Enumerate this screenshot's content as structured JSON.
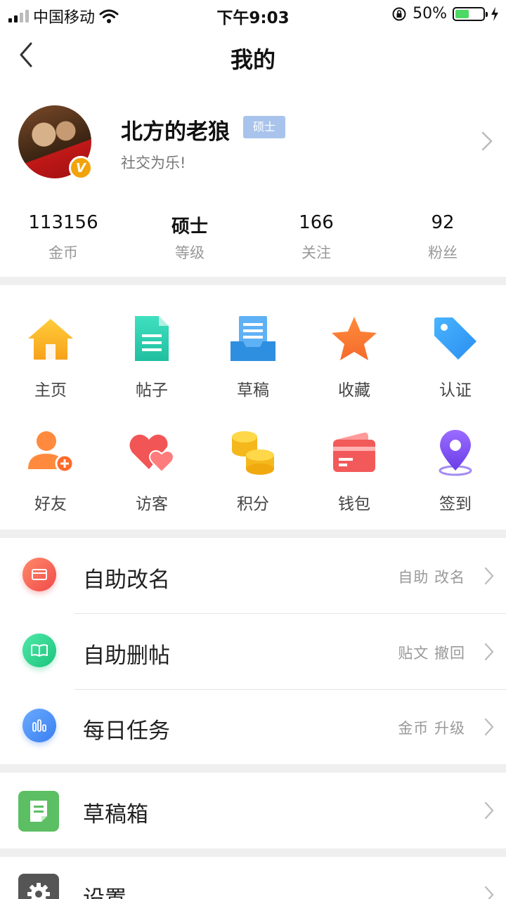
{
  "status_bar": {
    "carrier": "中国移动",
    "time": "下午9:03",
    "battery_percent": "50%",
    "battery_level": 0.5
  },
  "nav": {
    "title": "我的"
  },
  "profile": {
    "username": "北方的老狼",
    "level_badge": "硕士",
    "motto": "社交为乐!",
    "verified_badge": "V"
  },
  "stats": [
    {
      "value": "113156",
      "label": "金币"
    },
    {
      "value": "硕士",
      "label": "等级"
    },
    {
      "value": "166",
      "label": "关注"
    },
    {
      "value": "92",
      "label": "粉丝"
    }
  ],
  "grid": [
    {
      "label": "主页",
      "icon": "home-icon"
    },
    {
      "label": "帖子",
      "icon": "document-icon"
    },
    {
      "label": "草稿",
      "icon": "draft-tray-icon"
    },
    {
      "label": "收藏",
      "icon": "star-icon"
    },
    {
      "label": "认证",
      "icon": "tag-icon"
    },
    {
      "label": "好友",
      "icon": "add-friend-icon"
    },
    {
      "label": "访客",
      "icon": "hearts-icon"
    },
    {
      "label": "积分",
      "icon": "coins-icon"
    },
    {
      "label": "钱包",
      "icon": "wallet-icon"
    },
    {
      "label": "签到",
      "icon": "location-pin-icon"
    }
  ],
  "list": [
    {
      "title": "自助改名",
      "subtitle": "自助  改名",
      "icon": "card-icon",
      "color": "#f36a5a"
    },
    {
      "title": "自助删帖",
      "subtitle": "贴文  撤回",
      "icon": "book-icon",
      "color": "#2fd18a"
    },
    {
      "title": "每日任务",
      "subtitle": "金币  升级",
      "icon": "bar-chart-icon",
      "color": "#4a8df0"
    }
  ],
  "drafts": {
    "title": "草稿箱",
    "icon": "draft-box-icon",
    "color": "#5cbf63"
  },
  "settings": {
    "title": "设置",
    "icon": "gear-icon",
    "color": "#555555"
  }
}
